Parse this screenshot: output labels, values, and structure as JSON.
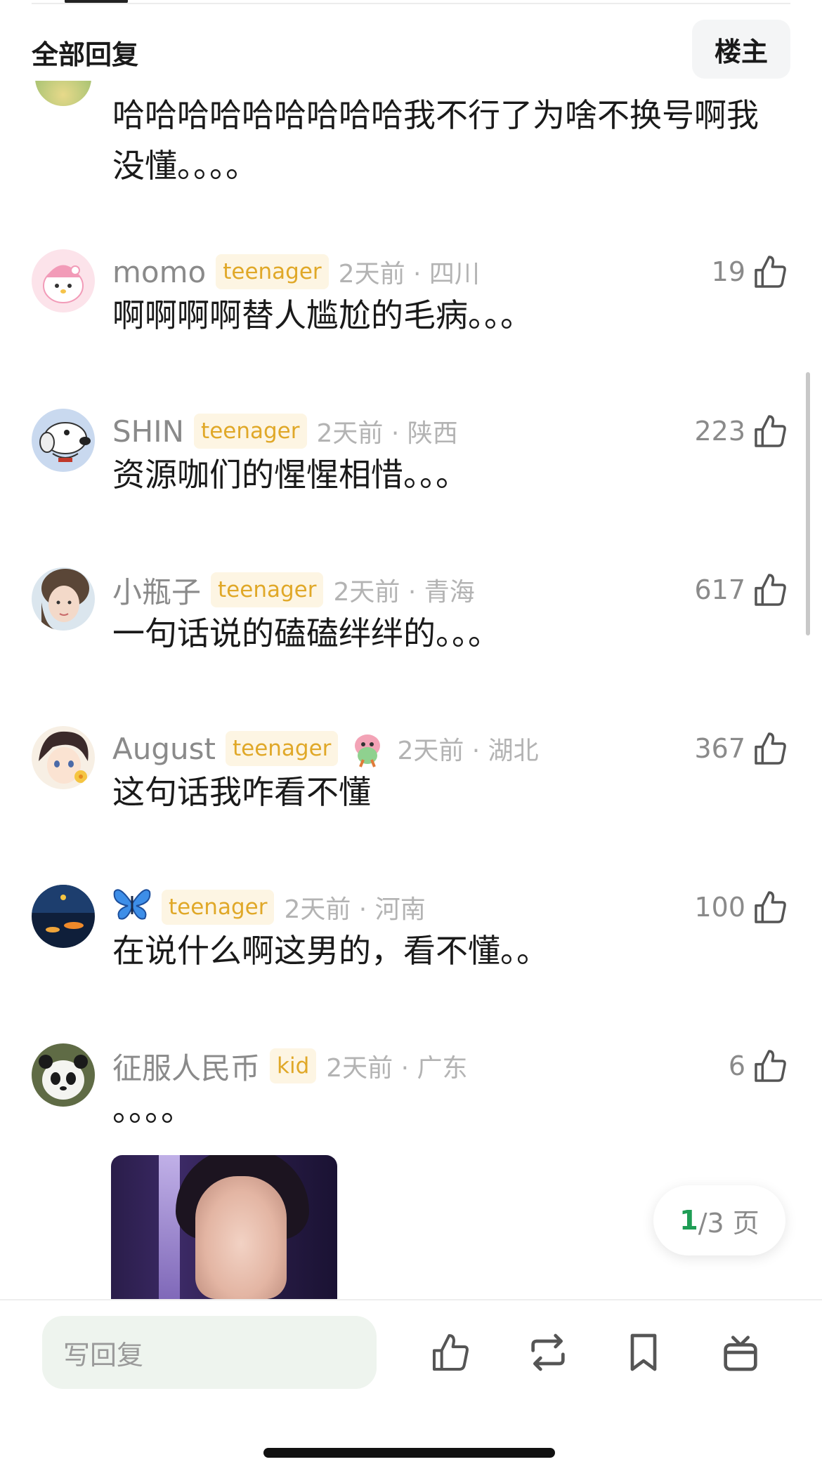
{
  "header": {
    "title": "全部回复",
    "owner_button": "楼主"
  },
  "partial_comment": {
    "text": "哈哈哈哈哈哈哈哈哈我不行了为啥不换号啊我没懂。。。。"
  },
  "comments": [
    {
      "username": "momo",
      "badge": "teenager",
      "time": "2天前 · 四川",
      "likes": "19",
      "content": "啊啊啊啊替人尴尬的毛病。。。"
    },
    {
      "username": "SHIN",
      "badge": "teenager",
      "time": "2天前 · 陕西",
      "likes": "223",
      "content": "资源咖们的惺惺相惜。。。"
    },
    {
      "username": "小瓶子",
      "badge": "teenager",
      "time": "2天前 · 青海",
      "likes": "617",
      "content": "一句话说的磕磕绊绊的。。。"
    },
    {
      "username": "August",
      "badge": "teenager",
      "time": "2天前 · 湖北",
      "likes": "367",
      "content": "这句话我咋看不懂"
    },
    {
      "username": "🦋",
      "badge": "teenager",
      "time": "2天前 · 河南",
      "likes": "100",
      "content": "在说什么啊这男的，看不懂。。"
    },
    {
      "username": "征服人民币",
      "badge": "kid",
      "time": "2天前 · 广东",
      "likes": "6",
      "content": "。。。。"
    }
  ],
  "pagination": {
    "current": "1",
    "rest": "/3 页"
  },
  "bottom_bar": {
    "reply_placeholder": "写回复"
  },
  "colors": {
    "badge_text": "#e0a828",
    "badge_bg": "#fdf5e3",
    "page_current": "#1f9d55",
    "input_bg": "#eef4ee"
  },
  "icons": [
    "thumbs-up-icon",
    "repost-icon",
    "bookmark-icon",
    "gift-icon",
    "butterfly-icon",
    "sticker-icon"
  ]
}
